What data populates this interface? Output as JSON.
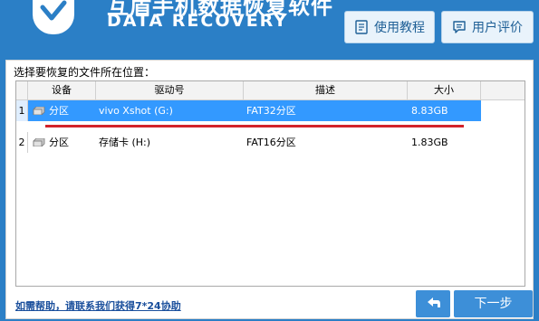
{
  "header": {
    "title_cn": "互盾手机数据恢复软件",
    "title_en": "DATA RECOVERY",
    "tutorial_label": "使用教程",
    "review_label": "用户评价",
    "logo_icon": "shield-check-icon"
  },
  "main": {
    "prompt": "选择要恢复的文件所在位置：",
    "columns": [
      "设备",
      "驱动号",
      "描述",
      "大小"
    ],
    "rows": [
      {
        "num": "1",
        "device": "分区",
        "drive": "vivo Xshot (G:)",
        "desc": "FAT32分区",
        "size": "8.83GB",
        "selected": true
      },
      {
        "num": "2",
        "device": "分区",
        "drive": "存储卡 (H:)",
        "desc": "FAT16分区",
        "size": "1.83GB",
        "selected": false
      }
    ]
  },
  "footer": {
    "help_text": "如需帮助，请联系我们获得7*24协助",
    "next_label": "下一步",
    "back_icon": "back-arrow-icon"
  },
  "colors": {
    "header_bg": "#2b7fc6",
    "selection": "#3399ff",
    "underline": "#d2232a",
    "button": "#3d8fd8"
  }
}
